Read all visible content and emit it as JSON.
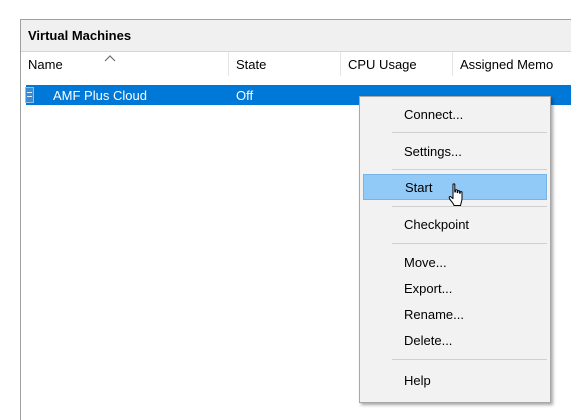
{
  "panel": {
    "title": "Virtual Machines"
  },
  "columns": [
    "Name",
    "State",
    "CPU Usage",
    "Assigned Memo"
  ],
  "vms": [
    {
      "name": "AMF Plus Cloud",
      "state": "Off",
      "selected": true
    }
  ],
  "context_menu": {
    "items": [
      "Connect...",
      "Settings...",
      "Start",
      "Checkpoint",
      "Move...",
      "Export...",
      "Rename...",
      "Delete...",
      "Help"
    ],
    "highlighted": "Start"
  },
  "colors": {
    "selection": "#0078d7",
    "menu_highlight": "#91c9f7",
    "menu_background": "#f2f2f2"
  }
}
